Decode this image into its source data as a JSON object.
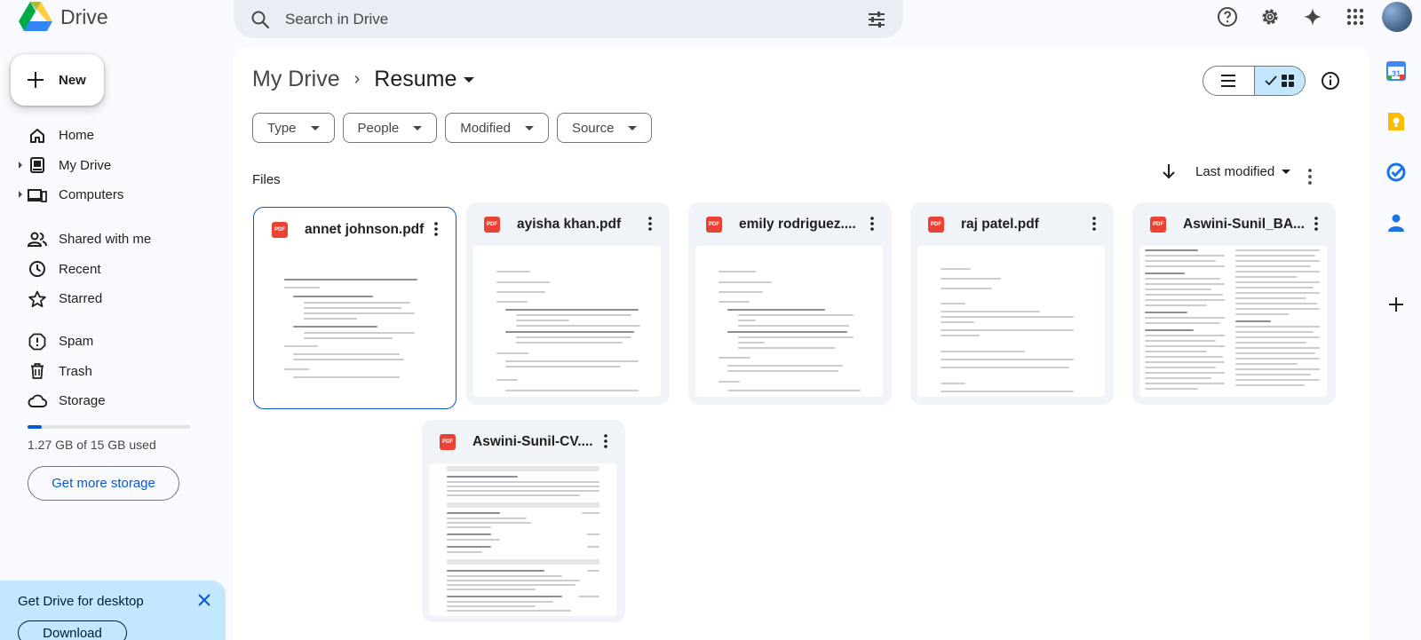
{
  "app": {
    "name": "Drive"
  },
  "search": {
    "placeholder": "Search in Drive"
  },
  "header_icons": [
    "help-icon",
    "settings-icon",
    "gemini-icon",
    "apps-icon",
    "account-avatar"
  ],
  "sidebar": {
    "new_label": "New",
    "items": [
      {
        "label": "Home",
        "icon": "home-icon",
        "caret": false
      },
      {
        "label": "My Drive",
        "icon": "my-drive-icon",
        "caret": true
      },
      {
        "label": "Computers",
        "icon": "computers-icon",
        "caret": true
      },
      {
        "label": "Shared with me",
        "icon": "shared-icon",
        "caret": false
      },
      {
        "label": "Recent",
        "icon": "clock-icon",
        "caret": false
      },
      {
        "label": "Starred",
        "icon": "star-icon",
        "caret": false
      },
      {
        "label": "Spam",
        "icon": "spam-icon",
        "caret": false
      },
      {
        "label": "Trash",
        "icon": "trash-icon",
        "caret": false
      },
      {
        "label": "Storage",
        "icon": "cloud-icon",
        "caret": false
      }
    ],
    "storage_text": "1.27 GB of 15 GB used",
    "storage_used_fraction": 0.085,
    "get_storage_label": "Get more storage"
  },
  "promo": {
    "title": "Get Drive for desktop",
    "download_label": "Download"
  },
  "breadcrumb": {
    "root": "My Drive",
    "separator": "›",
    "current": "Resume"
  },
  "filters": [
    "Type",
    "People",
    "Modified",
    "Source"
  ],
  "files_section": {
    "label": "Files",
    "sort_label": "Last modified"
  },
  "files": [
    {
      "name": "annet johnson.pdf",
      "type_badge": "PDF",
      "selected": true
    },
    {
      "name": "ayisha khan.pdf",
      "type_badge": "PDF",
      "selected": false
    },
    {
      "name": "emily rodriguez....",
      "type_badge": "PDF",
      "selected": false
    },
    {
      "name": "raj patel.pdf",
      "type_badge": "PDF",
      "selected": false
    },
    {
      "name": "Aswini-Sunil_BA...",
      "type_badge": "PDF",
      "selected": false
    },
    {
      "name": "Aswini-Sunil-CV....",
      "type_badge": "PDF",
      "selected": false
    }
  ],
  "right_rail": [
    "calendar-icon",
    "keep-icon",
    "tasks-icon",
    "contacts-icon",
    "add-icon"
  ],
  "colors": {
    "accent": "#0b57d0",
    "selected_bg": "#c2e7ff",
    "pdf_red": "#ea4335",
    "page_bg": "#f8fafd"
  }
}
